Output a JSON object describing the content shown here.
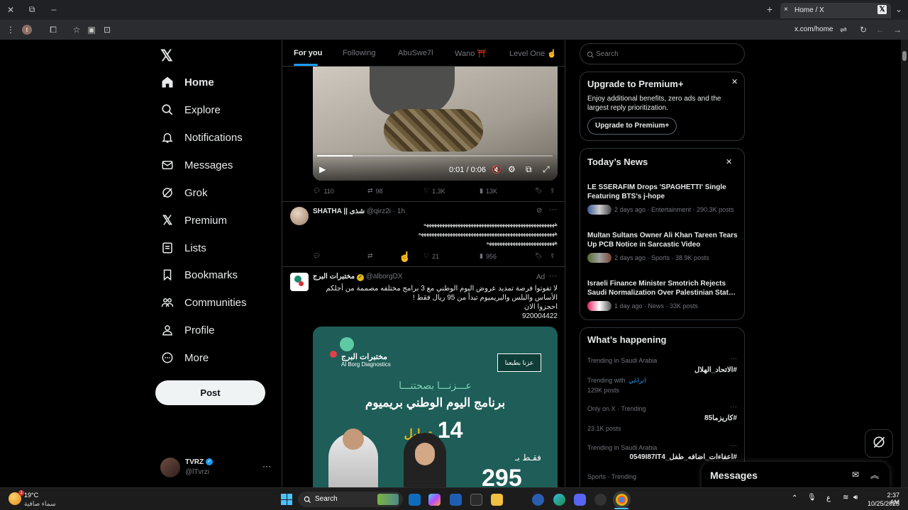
{
  "browser": {
    "tab_title": "Home / X",
    "url": "x.com/home",
    "tab_close": "×",
    "new_tab": "+",
    "site_badge": "t"
  },
  "nav": {
    "items": [
      {
        "label": "Home"
      },
      {
        "label": "Explore"
      },
      {
        "label": "Notifications"
      },
      {
        "label": "Messages"
      },
      {
        "label": "Grok"
      },
      {
        "label": "Premium"
      },
      {
        "label": "Lists"
      },
      {
        "label": "Bookmarks"
      },
      {
        "label": "Communities"
      },
      {
        "label": "Profile"
      },
      {
        "label": "More"
      }
    ],
    "post_label": "Post",
    "account": {
      "name": "TVRZ",
      "handle": "@lTvrzi",
      "more": "···"
    }
  },
  "feed": {
    "tabs": [
      "For you",
      "Following",
      "AbuSwe7l",
      "Wano ⛩️",
      "Level One ☝️"
    ],
    "video": {
      "time": "0:01 / 0:06"
    },
    "post1_actions": {
      "replies": "110",
      "reposts": "98",
      "likes": "1.3K",
      "views": "13K"
    },
    "post2": {
      "name": "SHATHA || شذى",
      "handle": "@qirz2i · 1h",
      "text_line1": "ههههههههههههههههههههههههههههههههههههههههههههههههههه",
      "text_line2": "ههههههههههههههههههههههههههههههههههههههههههههههههههههه",
      "text_line3": "ههههههههههههههههههههههههههه",
      "likes": "21",
      "views": "956"
    },
    "post3": {
      "name": "مختبرات البرج",
      "handle": "@alborgDX",
      "ad": "Ad",
      "text_line1": "لا تفوتوا فرصة تمديد عروض اليوم الوطني مع 3 برامج مختلفه مصممة من أجلكم",
      "text_line2": "الأساس والبلس والبريميوم تبدأ من 95 ريال فقط !",
      "text_line3": "احجزوا الان",
      "phone": "920004422",
      "ad_logo_ar": "مختبرات البرج",
      "ad_logo_en": "Al Borg Diagnostics",
      "ad_badge": "عزنا بطبعنا",
      "ad_headline1": "عـــزنـــا بصحتنـــا",
      "ad_headline2": "برنامج اليوم الوطني بريميوم",
      "ad_count": "14",
      "ad_count_label": "تحليل",
      "ad_price_label": "فقـط بـ",
      "ad_price": "295"
    }
  },
  "sidebar": {
    "search_placeholder": "Search",
    "premium": {
      "title": "Upgrade to Premium+",
      "body": "Enjoy additional benefits, zero ads and the largest reply prioritization.",
      "button": "Upgrade to Premium+"
    },
    "news": {
      "title": "Today’s News",
      "items": [
        {
          "title": "LE SSERAFIM Drops 'SPAGHETTI' Single Featuring BTS's j-hope",
          "meta": "2 days ago · Entertainment · 290.3K posts"
        },
        {
          "title": "Multan Sultans Owner Ali Khan Tareen Tears Up PCB Notice in Sarcastic Video",
          "meta": "2 days ago · Sports · 38.9K posts"
        },
        {
          "title": "Israeli Finance Minister Smotrich Rejects Saudi Normalization Over Palestinian Stat…",
          "meta": "1 day ago · News · 33K posts"
        }
      ]
    },
    "happening": {
      "title": "What’s happening",
      "trends": [
        {
          "category": "Trending in Saudi Arabia",
          "name": "#الاتحاد_الهلال",
          "sub": "Trending with",
          "sub_link": "اتراغي",
          "posts": "129K posts"
        },
        {
          "category": "Only on X · Trending",
          "name": "#كاريزما85",
          "posts": "23.1K posts"
        },
        {
          "category": "Trending in Saudi Arabia",
          "name": "#اعفاءات_اضافه_طفل_0549I87IT4",
          "posts": ""
        },
        {
          "category": "Sports · Trending",
          "name": "",
          "posts": ""
        }
      ]
    },
    "messages_title": "Messages"
  },
  "taskbar": {
    "weather_temp": "19°C",
    "weather_desc": "سماء صافية",
    "search": "Search",
    "time": "2:37 AM",
    "date": "10/25/2025",
    "lang": "ع",
    "notif_count": "1"
  },
  "colors": {
    "accent": "#1d9bf0",
    "background": "#000000",
    "border": "#2f3336",
    "muted": "#71767b"
  }
}
